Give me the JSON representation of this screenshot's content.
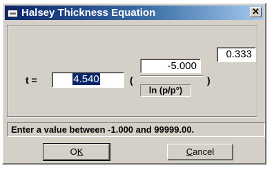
{
  "window": {
    "title": "Halsey Thickness Equation",
    "close_label": "✕"
  },
  "equation": {
    "t_label": "t =",
    "t_value": "4.540",
    "numerator": "-5.000",
    "exponent": "0.333",
    "denominator_label": "ln (p/p°)",
    "open_paren": "(",
    "close_paren": ")"
  },
  "status": {
    "text": "Enter a value between -1.000 and 99999.00."
  },
  "buttons": {
    "ok": {
      "pre": "O",
      "mnemonic": "K",
      "post": ""
    },
    "cancel": {
      "pre": "",
      "mnemonic": "C",
      "post": "ancel"
    }
  }
}
